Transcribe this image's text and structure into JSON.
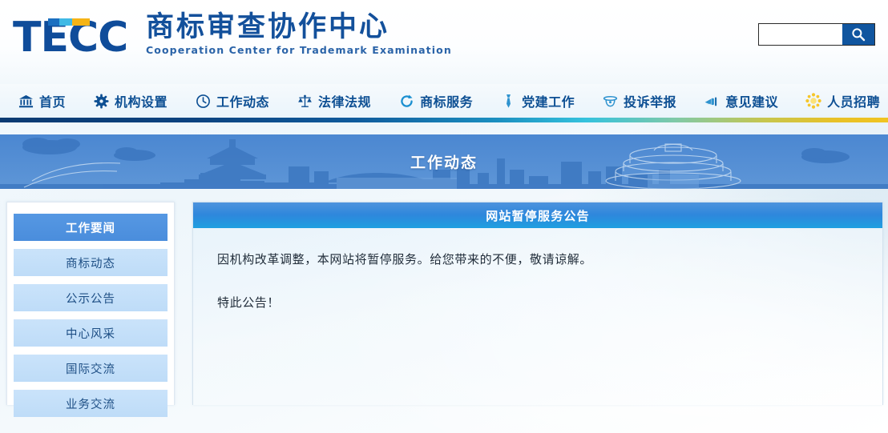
{
  "site": {
    "logo_text": "TECC",
    "name_cn": "商标审查协作中心",
    "name_en": "Cooperation Center for Trademark Examination"
  },
  "search": {
    "value": "",
    "placeholder": "",
    "button_icon": "search-icon"
  },
  "nav": {
    "items": [
      {
        "label": "首页",
        "icon": "bank-building-icon"
      },
      {
        "label": "机构设置",
        "icon": "gear-icon"
      },
      {
        "label": "工作动态",
        "icon": "clock-icon"
      },
      {
        "label": "法律法规",
        "icon": "balance-scales-icon"
      },
      {
        "label": "商标服务",
        "icon": "refresh-circle-icon"
      },
      {
        "label": "党建工作",
        "icon": "necktie-icon"
      },
      {
        "label": "投诉举报",
        "icon": "graduation-cap-icon"
      },
      {
        "label": "意见建议",
        "icon": "megaphone-icon"
      },
      {
        "label": "人员招聘",
        "icon": "sun-flower-icon"
      }
    ]
  },
  "banner": {
    "title": "工作动态"
  },
  "sidebar": {
    "items": [
      {
        "label": "工作要闻",
        "active": true
      },
      {
        "label": "商标动态",
        "active": false
      },
      {
        "label": "公示公告",
        "active": false
      },
      {
        "label": "中心风采",
        "active": false
      },
      {
        "label": "国际交流",
        "active": false
      },
      {
        "label": "业务交流",
        "active": false
      }
    ]
  },
  "panel": {
    "title": "网站暂停服务公告",
    "paragraphs": [
      "因机构改革调整，本网站将暂停服务。给您带来的不便，敬请谅解。",
      "特此公告！"
    ]
  },
  "colors": {
    "brand_blue": "#13509b",
    "nav_text": "#0d4f93",
    "accent_cyan": "#3fb9e5",
    "accent_gold": "#f5b416",
    "panel_header_blue": "#2e87dc",
    "sidebar_item_bg": "#c5e0f9",
    "sidebar_active_bg": "#4a8ddc"
  }
}
